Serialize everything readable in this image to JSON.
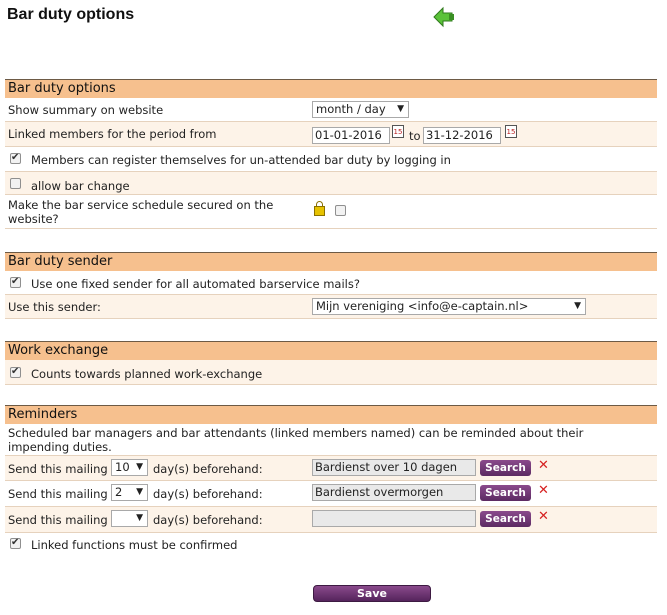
{
  "page": {
    "title": "Bar duty options"
  },
  "bar_duty_options": {
    "header": "Bar duty options",
    "summary_label": "Show summary on website",
    "summary_value": "month / day",
    "period_label": "Linked members for the period from",
    "period_from": "01-01-2016",
    "period_to_label": "to",
    "period_to": "31-12-2016",
    "register_label": "Members can register themselves for un-attended bar duty by logging in",
    "bar_change_label": "allow bar change",
    "secured_label": "Make the bar service schedule secured on the website?"
  },
  "sender": {
    "header": "Bar duty sender",
    "fixed_label": "Use one fixed sender for all automated barservice mails?",
    "use_label": "Use this sender:",
    "sender_value": "Mijn vereniging <info@e-captain.nl>"
  },
  "work_exchange": {
    "header": "Work exchange",
    "counts_label": "Counts towards planned work-exchange"
  },
  "reminders": {
    "header": "Reminders",
    "description": "Scheduled bar managers and bar attendants (linked members named) can be reminded about their impending duties.",
    "send_label": "Send this mailing",
    "days_label": "day(s) beforehand:",
    "search_label": "Search",
    "rows": [
      {
        "days": "10",
        "mailing": "Bardienst over 10 dagen"
      },
      {
        "days": "2",
        "mailing": "Bardienst overmorgen"
      },
      {
        "days": "",
        "mailing": ""
      }
    ],
    "confirm_label": "Linked functions must be confirmed"
  },
  "save_label": "Save"
}
